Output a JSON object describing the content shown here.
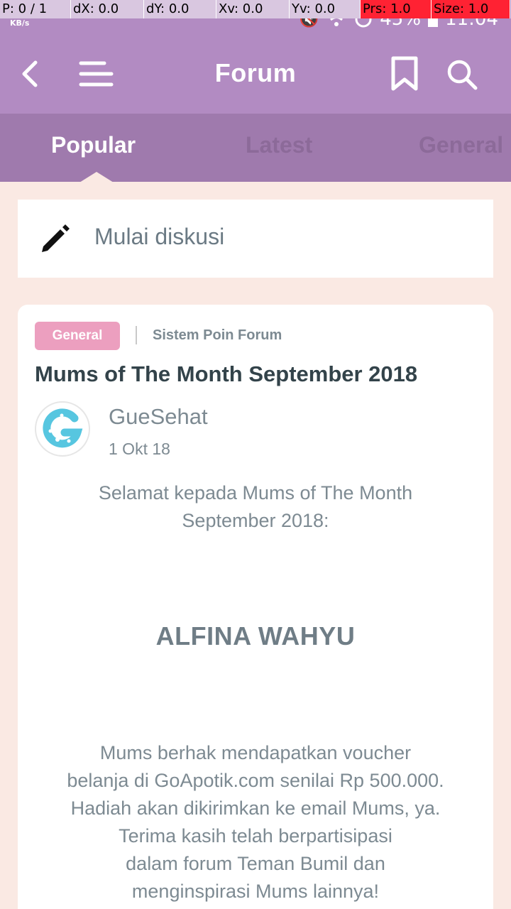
{
  "dev_overlay": {
    "pointer": "P: 0 / 1",
    "dx": "dX: 0.0",
    "dy": "dY: 0.0",
    "xv": "Xv: 0.0",
    "yv": "Yv: 0.0",
    "prs": "Prs: 1.0",
    "size": "Size: 1.0"
  },
  "status_bar": {
    "net_unit": "KB/s",
    "battery": "45%",
    "time": "11:04"
  },
  "appbar": {
    "title": "Forum",
    "bg_color": "#b28bc2"
  },
  "tabs": [
    {
      "label": "Popular",
      "active": true
    },
    {
      "label": "Latest",
      "active": false
    },
    {
      "label": "General",
      "active": false
    }
  ],
  "start_discussion": {
    "label": "Mulai diskusi"
  },
  "post": {
    "category": "General",
    "subcategory": "Sistem Poin Forum",
    "title": "Mums of The Month September 2018",
    "author": "GueSehat",
    "date": "1 Okt 18",
    "intro_line1": "Selamat kepada Mums of The Month",
    "intro_line2": "September 2018:",
    "winner": "ALFINA WAHYU",
    "prize_lines": [
      "Mums berhak mendapatkan voucher",
      "belanja di GoApotik.com senilai Rp 500.000.",
      "Hadiah akan dikirimkan ke email Mums, ya.",
      "Terima kasih telah berpartisipasi",
      "dalam forum Teman Bumil dan",
      "menginspirasi Mums lainnya!"
    ]
  },
  "colors": {
    "accent_purple": "#b28bc2",
    "tab_bar": "#9f7aad",
    "badge_pink": "#ec9fbf",
    "background": "#fae9e3"
  }
}
